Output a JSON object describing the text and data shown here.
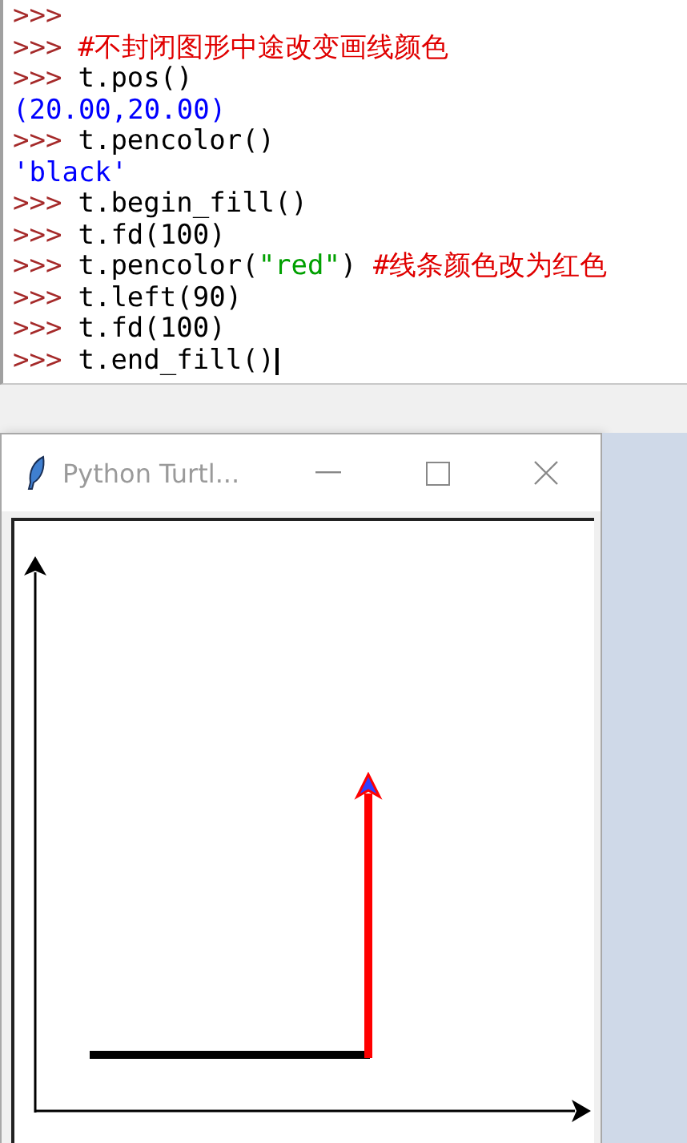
{
  "shell": {
    "lines": [
      {
        "prompt": ">>>"
      },
      {
        "prompt": ">>>",
        "parts": [
          {
            "kind": "comment",
            "text": "#不封闭图形中途改变画线颜色"
          }
        ]
      },
      {
        "prompt": ">>>",
        "parts": [
          {
            "kind": "code",
            "text": "t.pos()"
          }
        ]
      },
      {
        "parts": [
          {
            "kind": "output",
            "text": "(20.00,20.00)"
          }
        ]
      },
      {
        "prompt": ">>>",
        "parts": [
          {
            "kind": "code",
            "text": "t.pencolor()"
          }
        ]
      },
      {
        "parts": [
          {
            "kind": "output",
            "text": "'black'"
          }
        ]
      },
      {
        "prompt": ">>>",
        "parts": [
          {
            "kind": "code",
            "text": "t.begin_fill()"
          }
        ]
      },
      {
        "prompt": ">>>",
        "parts": [
          {
            "kind": "code",
            "text": "t.fd(100)"
          }
        ]
      },
      {
        "prompt": ">>>",
        "parts": [
          {
            "kind": "code",
            "text": "t.pencolor("
          },
          {
            "kind": "string",
            "text": "\"red\""
          },
          {
            "kind": "code",
            "text": ")"
          },
          {
            "kind": "comment",
            "text": " #线条颜色改为红色"
          }
        ]
      },
      {
        "prompt": ">>>",
        "parts": [
          {
            "kind": "code",
            "text": "t.left(90)"
          }
        ]
      },
      {
        "prompt": ">>>",
        "parts": [
          {
            "kind": "code",
            "text": "t.fd(100)"
          }
        ]
      },
      {
        "prompt": ">>>",
        "cursor": true,
        "parts": [
          {
            "kind": "code",
            "text": "t.end_fill()"
          }
        ]
      }
    ]
  },
  "turtle_window": {
    "title": "Python Turtl..."
  }
}
